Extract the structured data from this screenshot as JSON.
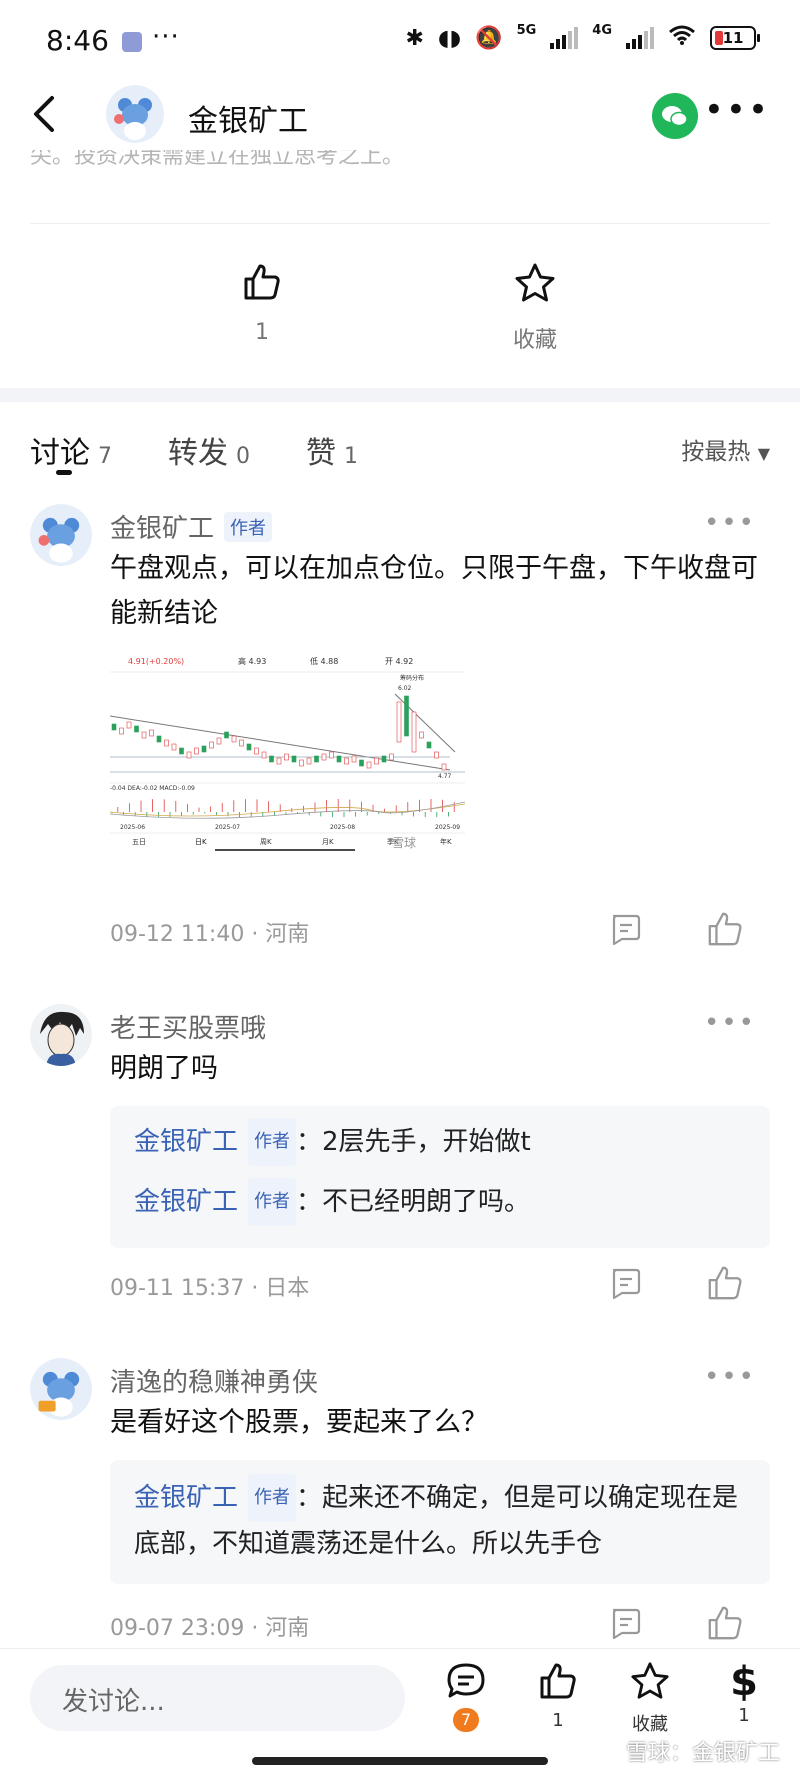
{
  "status": {
    "time": "8:46",
    "net1": "5G",
    "net2": "4G",
    "battery": "11"
  },
  "header": {
    "title": "金银矿工"
  },
  "cut_text": "尖。投资决策需建立在独立思考之上。",
  "actions": {
    "like_count": "1",
    "favorite_label": "收藏"
  },
  "tabs": [
    {
      "label": "讨论",
      "count": "7"
    },
    {
      "label": "转发",
      "count": "0"
    },
    {
      "label": "赞",
      "count": "1"
    }
  ],
  "sort_label": "按最热",
  "author_badge": "作者",
  "comments": [
    {
      "name": "金银矿工",
      "text": "午盘观点，可以在加点仓位。只限于午盘，下午收盘可能新结论",
      "meta": "09-12 11:40 · 河南",
      "chart": {
        "price": "4.91(+0.20%)",
        "high": "高 4.93",
        "low": "低 4.88",
        "open": "开 4.92",
        "peak": "6.02",
        "low_mark": "4.77",
        "tag": "筹码分布",
        "macd": "-0.04 DEA:-0.02 MACD:-0.09",
        "dates": [
          "2025-06",
          "2025-07",
          "2025-08",
          "2025-09"
        ],
        "periods": [
          "五日",
          "日K",
          "周K",
          "月K",
          "季K",
          "年K"
        ],
        "watermark": "雪球"
      }
    },
    {
      "name": "老王买股票哦",
      "text": "明朗了吗",
      "replies": [
        {
          "name": "金银矿工",
          "text": "：2层先手，开始做t"
        },
        {
          "name": "金银矿工",
          "text": "：不已经明朗了吗。"
        }
      ],
      "meta": "09-11 15:37 · 日本"
    },
    {
      "name": "清逸的稳赚神勇侠",
      "text": "是看好这个股票，要起来了么？",
      "replies": [
        {
          "name": "金银矿工",
          "text": "：起来还不确定，但是可以确定现在是底部，不知道震荡还是什么。所以先手仓"
        }
      ],
      "meta": "09-07 23:09 · 河南"
    }
  ],
  "bottom": {
    "placeholder": "发讨论...",
    "comment_count": "7",
    "like_count": "1",
    "favorite_label": "收藏",
    "reward_count": "1",
    "watermark": "雪球：金银矿工"
  }
}
